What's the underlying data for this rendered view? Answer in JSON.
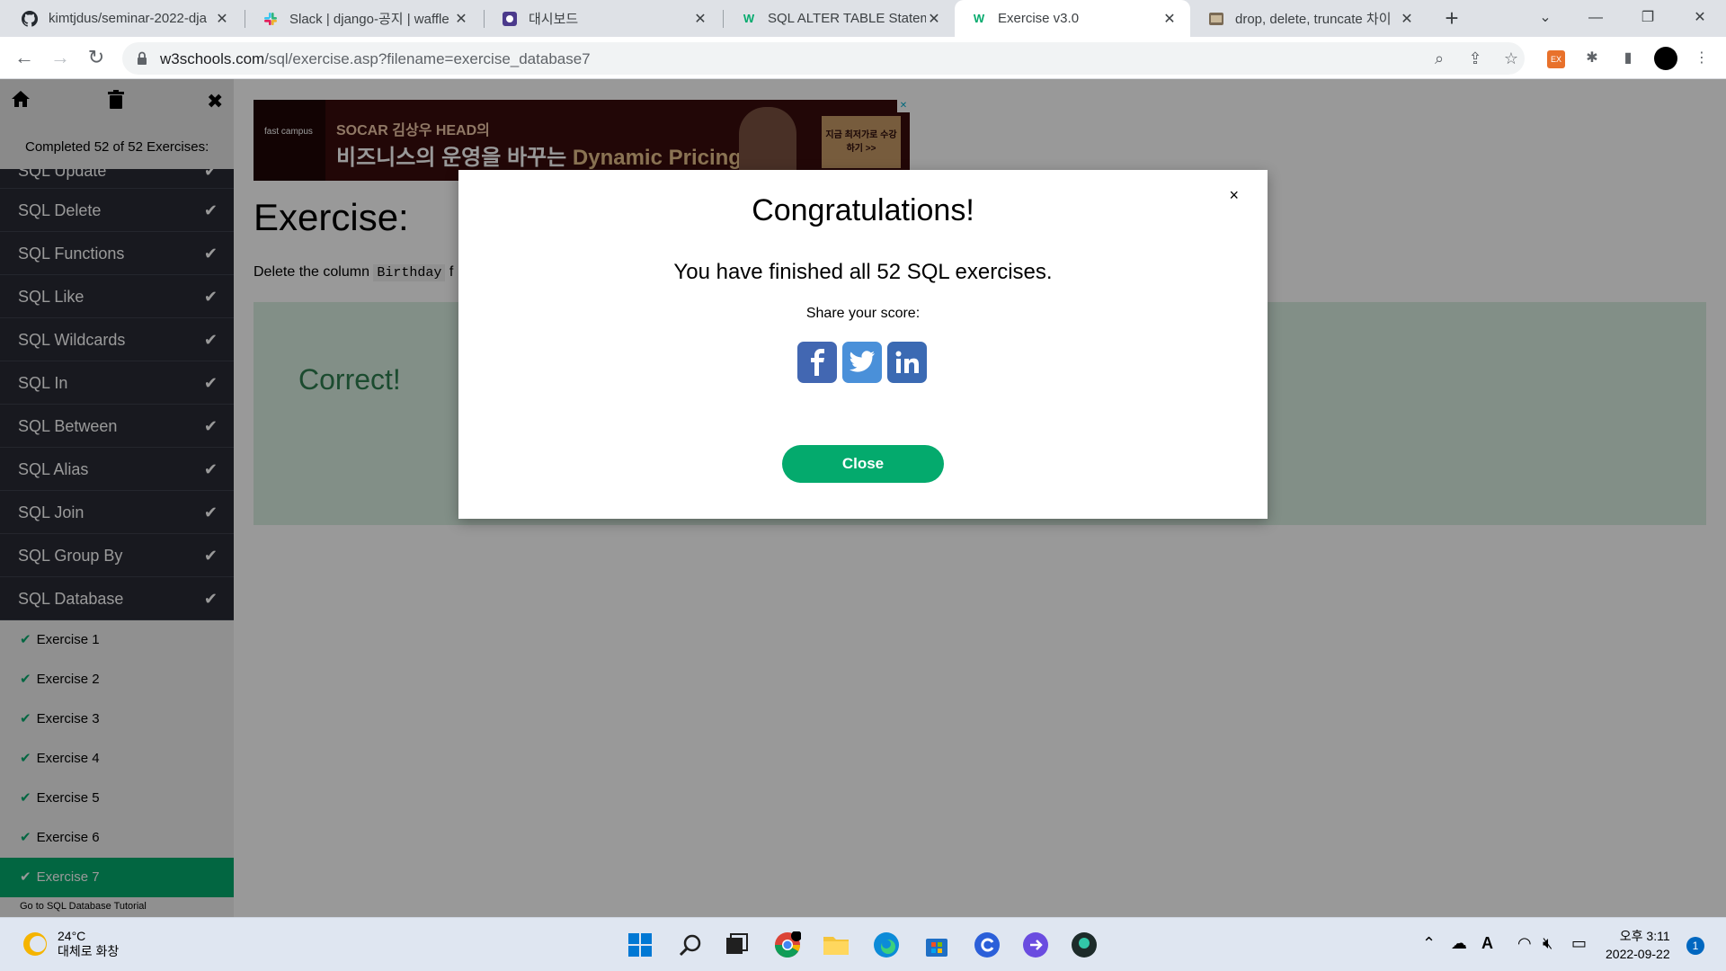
{
  "browser": {
    "tabs": [
      {
        "title": "kimtjdus/seminar-2022-dja",
        "icon": "github-icon"
      },
      {
        "title": "Slack | django-공지 | waffle",
        "icon": "slack-icon"
      },
      {
        "title": "대시보드",
        "icon": "dashboard-icon"
      },
      {
        "title": "SQL ALTER TABLE Statemen",
        "icon": "w3schools-icon"
      },
      {
        "title": "Exercise v3.0",
        "icon": "w3schools-icon"
      },
      {
        "title": "drop, delete, truncate 차이",
        "icon": "blog-icon"
      }
    ],
    "active_tab": 4,
    "url_host": "w3schools.com",
    "url_path": "/sql/exercise.asp?filename=exercise_database7"
  },
  "sidebar": {
    "progress_text": "Completed 52 of 52 Exercises:",
    "partial_item": "SQL Update",
    "items": [
      {
        "label": "SQL Delete"
      },
      {
        "label": "SQL Functions"
      },
      {
        "label": "SQL Like"
      },
      {
        "label": "SQL Wildcards"
      },
      {
        "label": "SQL In"
      },
      {
        "label": "SQL Between"
      },
      {
        "label": "SQL Alias"
      },
      {
        "label": "SQL Join"
      },
      {
        "label": "SQL Group By"
      },
      {
        "label": "SQL Database"
      }
    ],
    "exercises": [
      {
        "label": "Exercise 1"
      },
      {
        "label": "Exercise 2"
      },
      {
        "label": "Exercise 3"
      },
      {
        "label": "Exercise 4"
      },
      {
        "label": "Exercise 5"
      },
      {
        "label": "Exercise 6"
      },
      {
        "label": "Exercise 7"
      }
    ],
    "more_link": "Go to SQL Database Tutorial"
  },
  "ad": {
    "brand": "fast campus",
    "line1": "SOCAR 김상우 HEAD의",
    "line2_prefix": "비즈니스의 운영을 바꾸는 ",
    "line2_highlight": "Dynamic Pricing",
    "cta": "지금 최저가로 수강하기 >>"
  },
  "main": {
    "title": "Exercise:",
    "instruction_prefix": "Delete the column ",
    "instruction_code": "Birthday",
    "instruction_suffix": " f",
    "result": "Correct!"
  },
  "modal": {
    "title": "Congratulations!",
    "message": "You have finished all 52 SQL exercises.",
    "share_label": "Share your score:",
    "close_label": "Close",
    "close_x": "×",
    "socials": [
      "facebook-icon",
      "twitter-icon",
      "linkedin-icon"
    ]
  },
  "taskbar": {
    "temperature": "24°C",
    "weather_desc": "대체로 화창",
    "time": "오후 3:11",
    "date": "2022-09-22",
    "notification_count": "1"
  },
  "colors": {
    "w3_green": "#04aa6d",
    "sidebar_dark": "#282a35",
    "correct_bg": "#d9eee1"
  }
}
